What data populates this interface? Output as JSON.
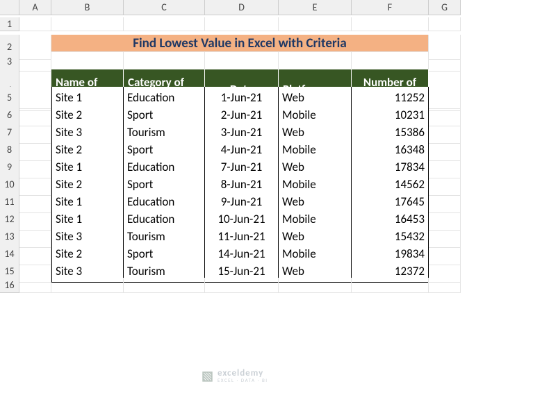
{
  "columns": [
    "A",
    "B",
    "C",
    "D",
    "E",
    "F",
    "G"
  ],
  "title": "Find Lowest Value in Excel with Criteria",
  "headers": {
    "name": "Name of Sites",
    "category": "Category of the Sites",
    "date": "Date",
    "platforms": "Platforms",
    "visits": "Number of Visits"
  },
  "rows": [
    {
      "name": "Site 1",
      "category": "Education",
      "date": "1-Jun-21",
      "platform": "Web",
      "visits": "11252"
    },
    {
      "name": "Site 2",
      "category": "Sport",
      "date": "2-Jun-21",
      "platform": "Mobile",
      "visits": "10231"
    },
    {
      "name": "Site 3",
      "category": "Tourism",
      "date": "3-Jun-21",
      "platform": "Web",
      "visits": "15386"
    },
    {
      "name": "Site 2",
      "category": "Sport",
      "date": "4-Jun-21",
      "platform": "Mobile",
      "visits": "16348"
    },
    {
      "name": "Site 1",
      "category": "Education",
      "date": "7-Jun-21",
      "platform": "Web",
      "visits": "17834"
    },
    {
      "name": "Site 2",
      "category": "Sport",
      "date": "8-Jun-21",
      "platform": "Mobile",
      "visits": "14562"
    },
    {
      "name": "Site 1",
      "category": "Education",
      "date": "9-Jun-21",
      "platform": "Web",
      "visits": "17645"
    },
    {
      "name": "Site 1",
      "category": "Education",
      "date": "10-Jun-21",
      "platform": "Mobile",
      "visits": "16453"
    },
    {
      "name": "Site 3",
      "category": "Tourism",
      "date": "11-Jun-21",
      "platform": "Web",
      "visits": "15432"
    },
    {
      "name": "Site 2",
      "category": "Sport",
      "date": "14-Jun-21",
      "platform": "Mobile",
      "visits": "19834"
    },
    {
      "name": "Site 3",
      "category": "Tourism",
      "date": "15-Jun-21",
      "platform": "Web",
      "visits": "12372"
    }
  ],
  "watermark": {
    "brand": "exceldemy",
    "tag": "EXCEL · DATA · BI"
  },
  "chart_data": {
    "type": "table",
    "title": "Find Lowest Value in Excel with Criteria",
    "columns": [
      "Name of Sites",
      "Category of the Sites",
      "Date",
      "Platforms",
      "Number of Visits"
    ],
    "data": [
      [
        "Site 1",
        "Education",
        "1-Jun-21",
        "Web",
        11252
      ],
      [
        "Site 2",
        "Sport",
        "2-Jun-21",
        "Mobile",
        10231
      ],
      [
        "Site 3",
        "Tourism",
        "3-Jun-21",
        "Web",
        15386
      ],
      [
        "Site 2",
        "Sport",
        "4-Jun-21",
        "Mobile",
        16348
      ],
      [
        "Site 1",
        "Education",
        "7-Jun-21",
        "Web",
        17834
      ],
      [
        "Site 2",
        "Sport",
        "8-Jun-21",
        "Mobile",
        14562
      ],
      [
        "Site 1",
        "Education",
        "9-Jun-21",
        "Web",
        17645
      ],
      [
        "Site 1",
        "Education",
        "10-Jun-21",
        "Mobile",
        16453
      ],
      [
        "Site 3",
        "Tourism",
        "11-Jun-21",
        "Web",
        15432
      ],
      [
        "Site 2",
        "Sport",
        "14-Jun-21",
        "Mobile",
        19834
      ],
      [
        "Site 3",
        "Tourism",
        "15-Jun-21",
        "Web",
        12372
      ]
    ]
  }
}
